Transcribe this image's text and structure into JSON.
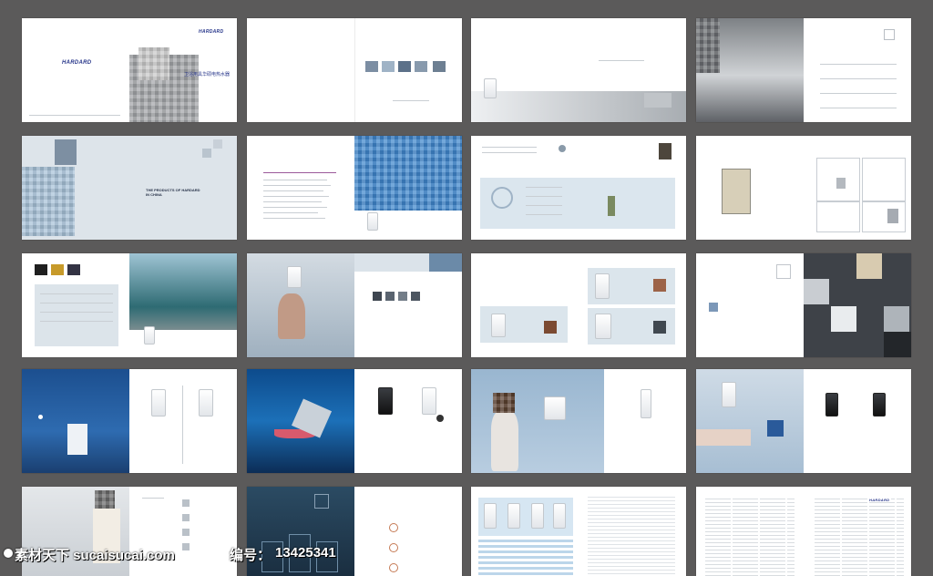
{
  "brand": {
    "logo_text": "HARDARD"
  },
  "cover_caption": "卫浴用具华硕电热水器",
  "watermark": {
    "site": "素材天下 sucaisucai.com",
    "code_label": "编号：",
    "code_value": "13425341"
  },
  "spreads": [
    {
      "name": "cover"
    },
    {
      "name": "intro-thumbnails"
    },
    {
      "name": "bathroom-chairs"
    },
    {
      "name": "showroom-photo"
    },
    {
      "name": "products-of-china"
    },
    {
      "name": "blue-portrait"
    },
    {
      "name": "feature-diagram"
    },
    {
      "name": "circuit-board"
    },
    {
      "name": "bath-interior"
    },
    {
      "name": "stretching-woman"
    },
    {
      "name": "product-cards"
    },
    {
      "name": "dark-collage"
    },
    {
      "name": "night-moon"
    },
    {
      "name": "cocktail-city"
    },
    {
      "name": "shower-woman"
    },
    {
      "name": "bathtub"
    },
    {
      "name": "washbasin"
    },
    {
      "name": "dark-display"
    },
    {
      "name": "spec-table"
    },
    {
      "name": "text-index"
    }
  ],
  "english_heading": "THE PRODUCTS OF HARDARD IN CHINA",
  "colors": {
    "background": "#5b5a5a",
    "brand_blue": "#27368a",
    "panel_blue": "#d9e4ec",
    "night_blue": "#1d4f93"
  }
}
